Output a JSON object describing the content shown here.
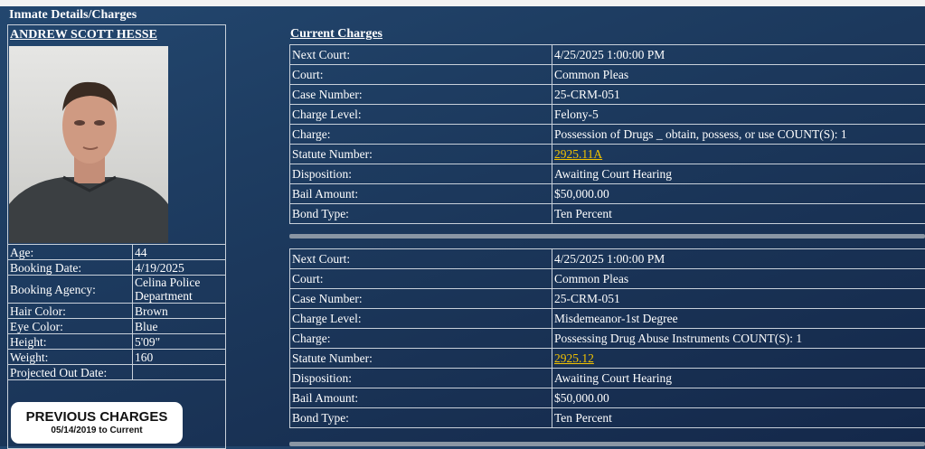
{
  "page": {
    "section_title": "Inmate Details/Charges"
  },
  "inmate": {
    "name": "ANDREW SCOTT HESSE",
    "details": [
      {
        "label": "Age:",
        "value": "44"
      },
      {
        "label": "Booking Date:",
        "value": "4/19/2025"
      },
      {
        "label": "Booking Agency:",
        "value": "Celina Police Department"
      },
      {
        "label": "Hair Color:",
        "value": "Brown"
      },
      {
        "label": "Eye Color:",
        "value": "Blue"
      },
      {
        "label": "Height:",
        "value": "5'09\""
      },
      {
        "label": "Weight:",
        "value": "160"
      },
      {
        "label": "Projected Out Date:",
        "value": ""
      }
    ]
  },
  "previous_charges": {
    "title": "PREVIOUS CHARGES",
    "subtitle": "05/14/2019 to Current"
  },
  "charges": {
    "title": "Current Charges",
    "items": [
      {
        "rows": [
          {
            "label": "Next Court:",
            "value": "4/25/2025 1:00:00 PM"
          },
          {
            "label": "Court:",
            "value": "Common Pleas"
          },
          {
            "label": "Case Number:",
            "value": "25-CRM-051"
          },
          {
            "label": "Charge Level:",
            "value": "Felony-5"
          },
          {
            "label": "Charge:",
            "value": "Possession of Drugs _ obtain, possess, or use  COUNT(S): 1"
          },
          {
            "label": "Statute Number:",
            "value": "2925.11A"
          },
          {
            "label": "Disposition:",
            "value": "Awaiting Court Hearing"
          },
          {
            "label": "Bail Amount:",
            "value": "$50,000.00"
          },
          {
            "label": "Bond Type:",
            "value": "Ten Percent"
          }
        ]
      },
      {
        "rows": [
          {
            "label": "Next Court:",
            "value": "4/25/2025 1:00:00 PM"
          },
          {
            "label": "Court:",
            "value": "Common Pleas"
          },
          {
            "label": "Case Number:",
            "value": "25-CRM-051"
          },
          {
            "label": "Charge Level:",
            "value": "Misdemeanor-1st Degree"
          },
          {
            "label": "Charge:",
            "value": "Possessing Drug Abuse Instruments  COUNT(S): 1"
          },
          {
            "label": "Statute Number:",
            "value": "2925.12"
          },
          {
            "label": "Disposition:",
            "value": "Awaiting Court Hearing"
          },
          {
            "label": "Bail Amount:",
            "value": "$50,000.00"
          },
          {
            "label": "Bond Type:",
            "value": "Ten Percent"
          }
        ]
      }
    ]
  },
  "colors": {
    "background": "#1e3d62",
    "link": "#f2c200",
    "border": "#c8d0da"
  }
}
